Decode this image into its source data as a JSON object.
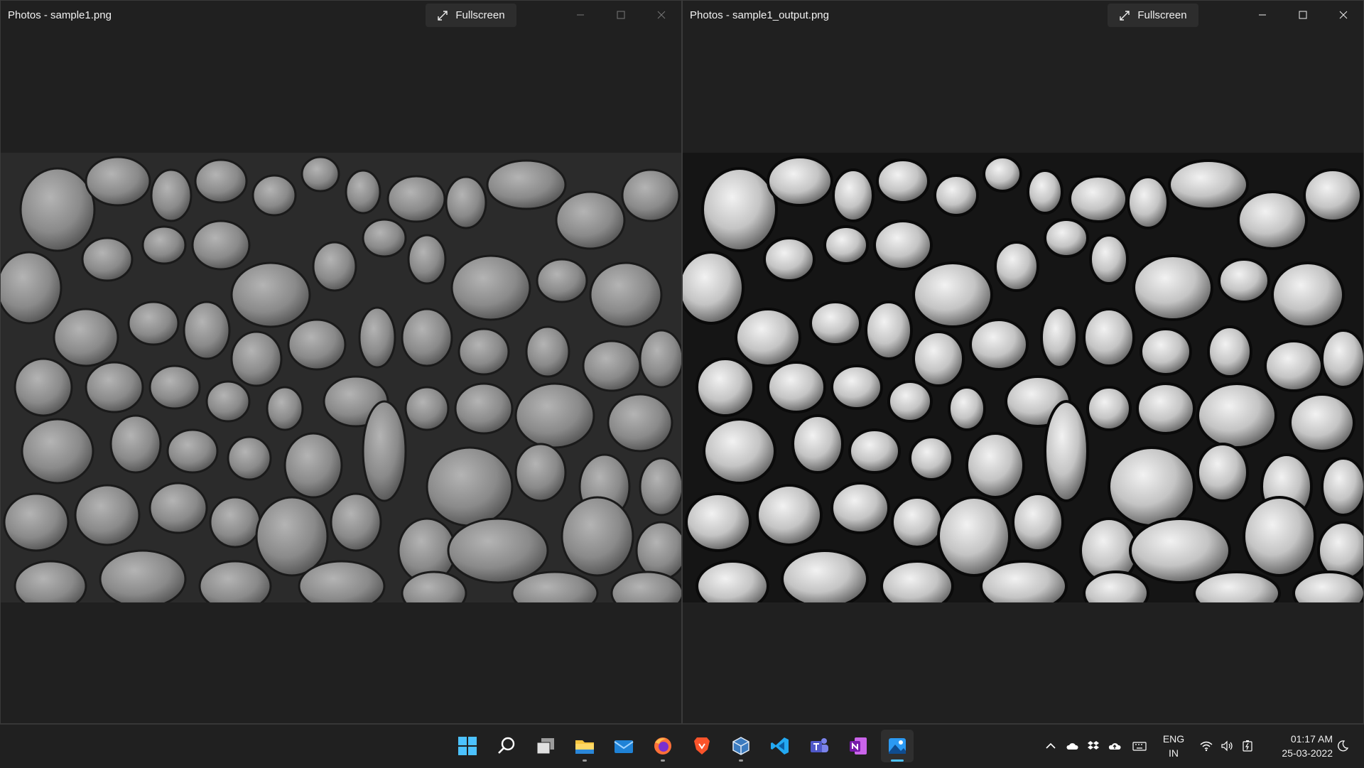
{
  "windows": {
    "left": {
      "title": "Photos - sample1.png",
      "fullscreen_label": "Fullscreen"
    },
    "right": {
      "title": "Photos - sample1_output.png",
      "fullscreen_label": "Fullscreen"
    }
  },
  "taskbar": {
    "apps": [
      {
        "name": "Start",
        "icon": "windows-logo-icon"
      },
      {
        "name": "Search",
        "icon": "search-icon"
      },
      {
        "name": "Task View",
        "icon": "task-view-icon"
      },
      {
        "name": "File Explorer",
        "icon": "folder-icon",
        "running": true
      },
      {
        "name": "Mail",
        "icon": "mail-icon"
      },
      {
        "name": "Firefox",
        "icon": "firefox-icon",
        "running": true
      },
      {
        "name": "Brave",
        "icon": "brave-icon"
      },
      {
        "name": "VirtualBox",
        "icon": "virtualbox-icon",
        "running": true
      },
      {
        "name": "Visual Studio Code",
        "icon": "vscode-icon"
      },
      {
        "name": "Teams",
        "icon": "teams-icon"
      },
      {
        "name": "OneNote",
        "icon": "onenote-icon"
      },
      {
        "name": "Photos",
        "icon": "photos-icon",
        "active": true
      }
    ],
    "tray": {
      "language_top": "ENG",
      "language_bottom": "IN",
      "time": "01:17 AM",
      "date": "25-03-2022"
    }
  },
  "colors": {
    "window_bg": "#202020",
    "taskbar_bg": "#202020",
    "accent": "#4cc2ff"
  }
}
